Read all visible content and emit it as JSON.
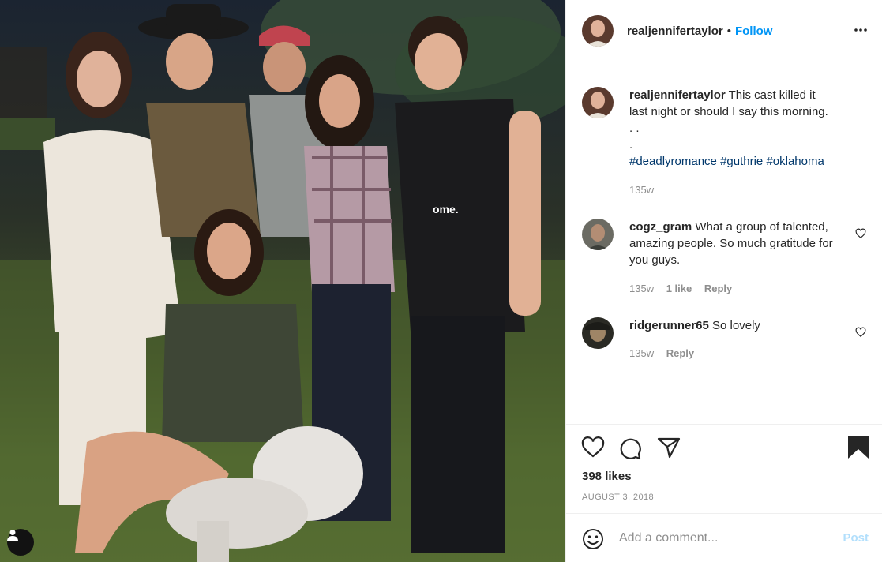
{
  "post": {
    "username": "realjennifertaylor",
    "separator": "•",
    "follow_label": "Follow",
    "more_icon": "more-horizontal-icon"
  },
  "caption": {
    "username": "realjennifertaylor",
    "text_line1": "This cast killed it",
    "text_line2": "last night or should I say this morning.",
    "text_line3": ". .",
    "text_line4": ".",
    "hashtags": "#deadlyromance #guthrie #oklahoma",
    "time": "135w"
  },
  "comments": [
    {
      "username": "cogz_gram",
      "text": "What a group of talented, amazing people. So much gratitude for you guys.",
      "time": "135w",
      "likes": "1 like",
      "reply": "Reply"
    },
    {
      "username": "ridgerunner65",
      "text": "So lovely",
      "time": "135w",
      "reply": "Reply"
    }
  ],
  "actions": {
    "likes": "398 likes",
    "date": "AUGUST 3, 2018",
    "icons": [
      "heart-icon",
      "comment-icon",
      "share-icon",
      "bookmark-icon"
    ]
  },
  "add_comment": {
    "placeholder": "Add a comment...",
    "post_label": "Post"
  },
  "photo": {
    "shirt_text": "ome."
  },
  "colors": {
    "accent": "#0095f6",
    "post_disabled": "#b2dffc",
    "hashtag": "#00376b",
    "muted": "#8e8e8e"
  }
}
